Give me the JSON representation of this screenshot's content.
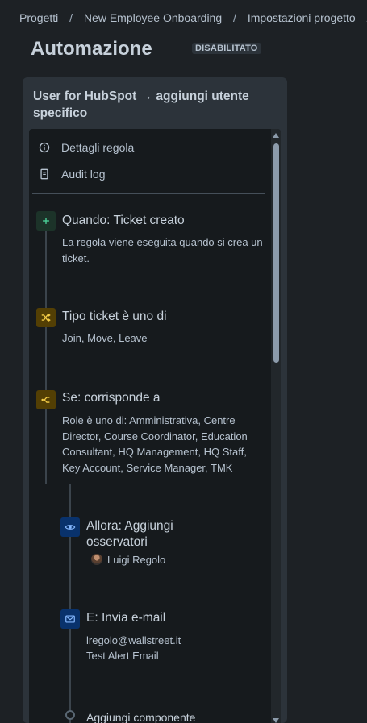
{
  "breadcrumb": {
    "items": [
      "Progetti",
      "New Employee Onboarding",
      "Impostazioni progetto"
    ],
    "separator": "/"
  },
  "page": {
    "title": "Automazione",
    "status": "DISABILITATO"
  },
  "rule": {
    "title": "User for HubSpot → aggiungi utente specifico",
    "menu": [
      {
        "label": "Dettagli regola",
        "icon": "info-icon"
      },
      {
        "label": "Audit log",
        "icon": "document-icon"
      }
    ],
    "trigger": {
      "title": "Quando: Ticket creato",
      "description": "La regola viene eseguita quando si crea un ticket.",
      "icon": "plus-icon",
      "color": "#1f845a"
    },
    "condition": {
      "title": "Tipo ticket è uno di",
      "description": "Join, Move, Leave",
      "icon": "shuffle-icon",
      "color": "#e2b203"
    },
    "branch": {
      "title": "Se: corrisponde a",
      "description": "Role è uno di: Amministrativa, Centre Director, Course Coordinator, Education Consultant, HQ Management, HQ Staff, Key Account, Service Manager, TMK",
      "icon": "branch-icon",
      "color": "#e2b203"
    },
    "action_watchers": {
      "title": "Allora: Aggiungi osservatori",
      "user": "Luigi Regolo",
      "icon": "eye-icon",
      "color": "#579dff"
    },
    "action_email": {
      "title": "E: Invia e-mail",
      "to": "lregolo@wallstreet.it",
      "subject": "Test Alert Email",
      "icon": "mail-icon",
      "color": "#579dff"
    },
    "add_component": "Aggiungi componente"
  }
}
